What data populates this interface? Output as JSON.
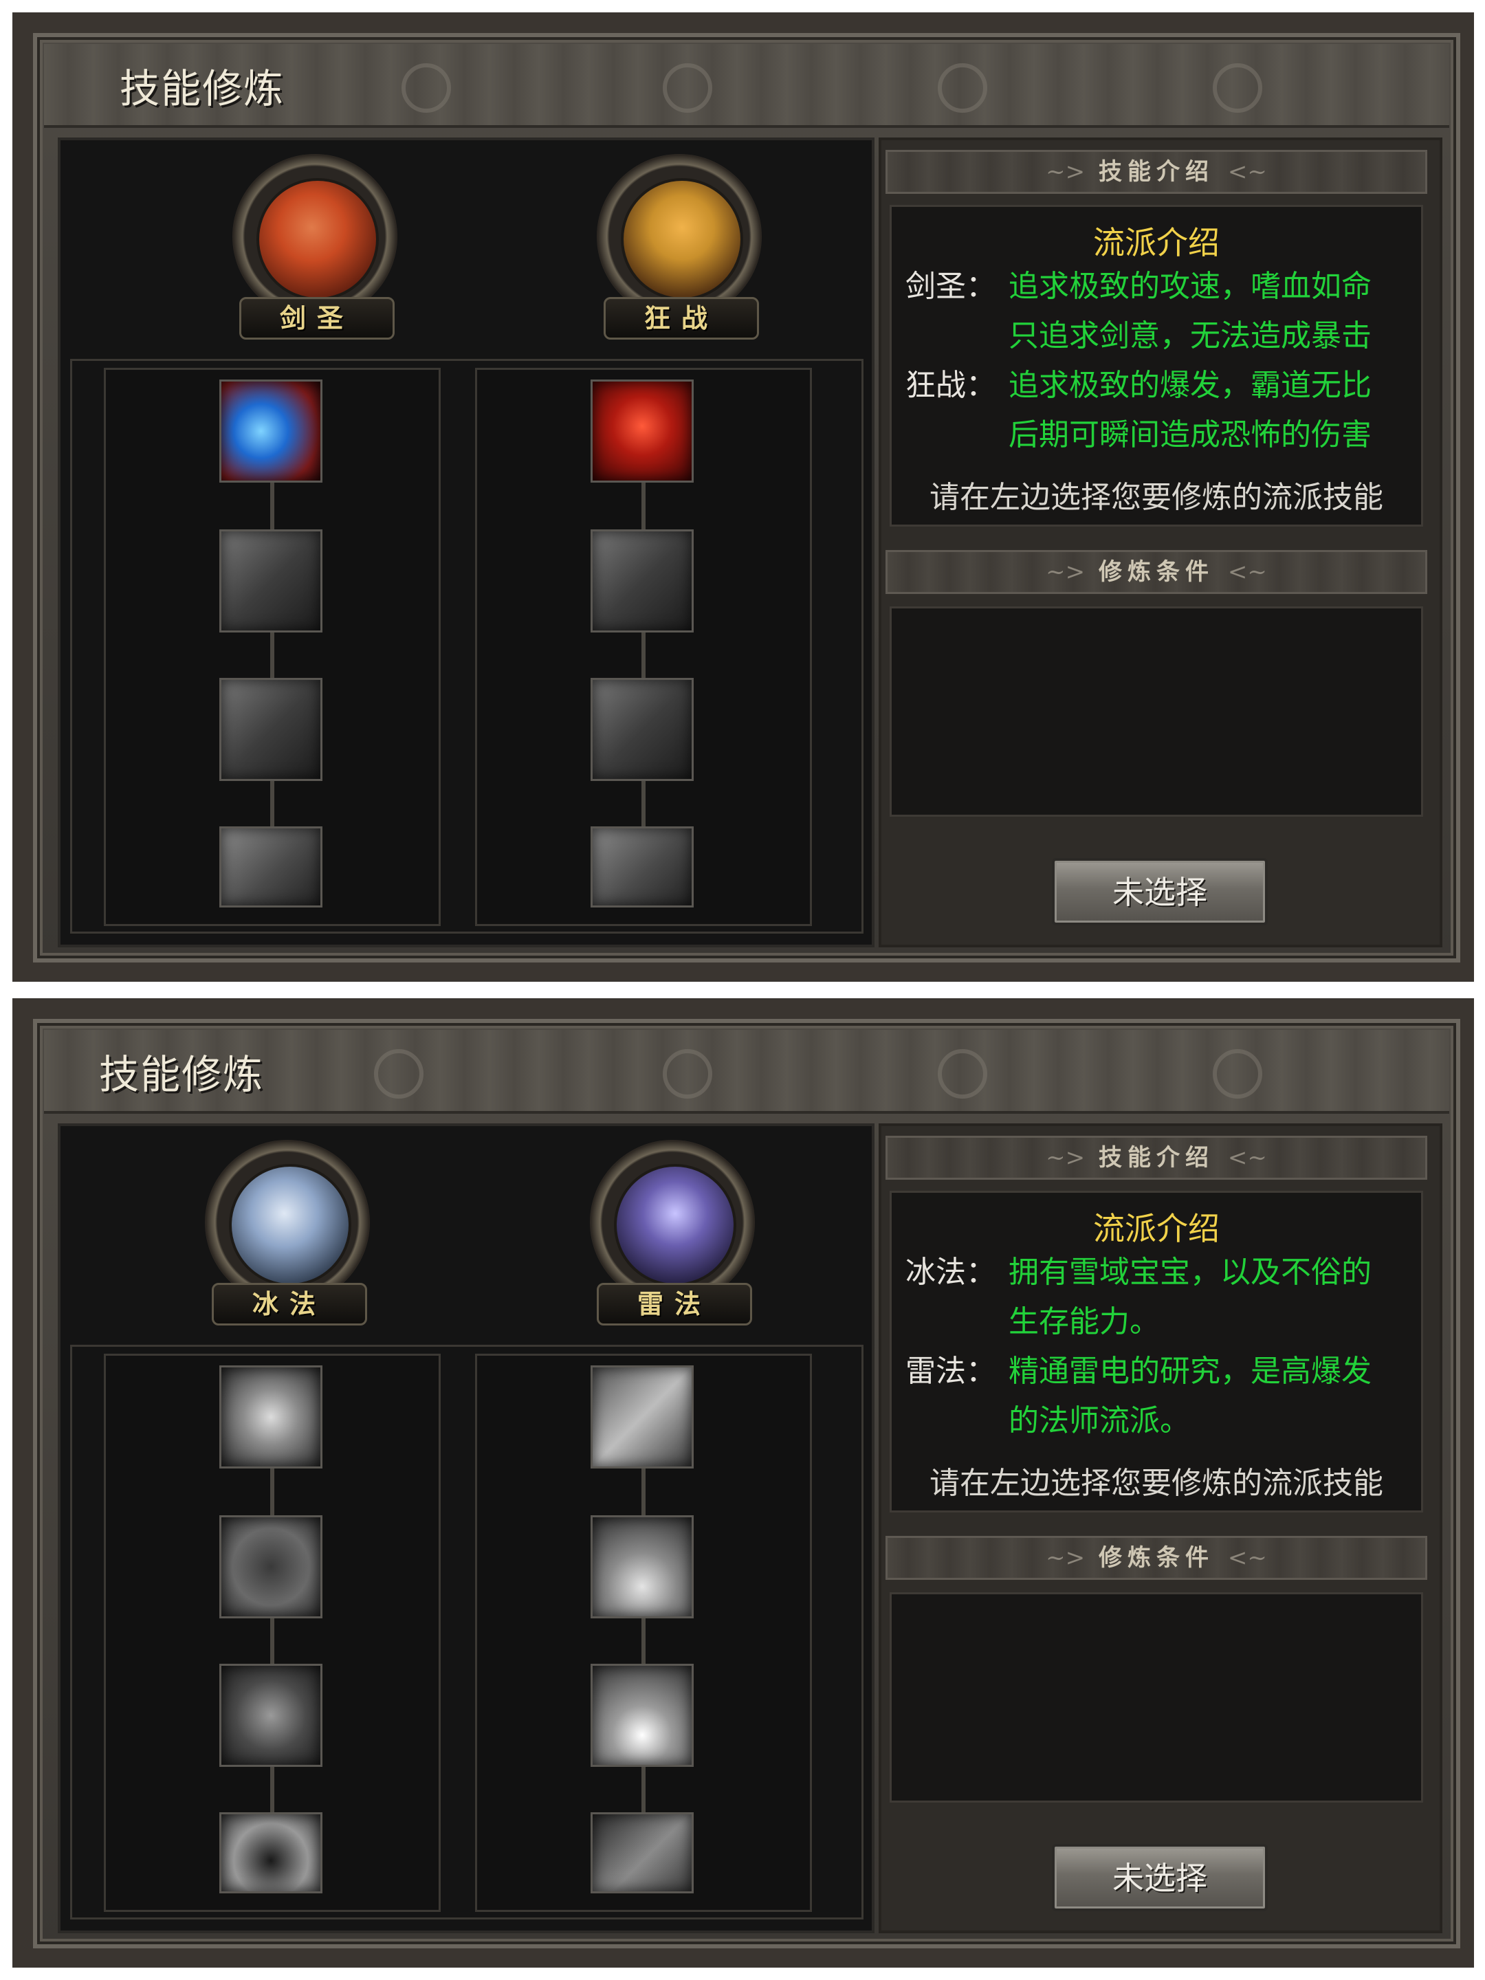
{
  "panels": [
    {
      "title": "技能修炼",
      "classes": [
        {
          "name": "剑圣",
          "face_colors": [
            "#c94a22",
            "#3a1a10"
          ]
        },
        {
          "name": "狂战",
          "face_colors": [
            "#c9902c",
            "#3a2510"
          ]
        }
      ],
      "skill_intro_header": "技能介绍",
      "intro_title": "流派介绍",
      "descriptions": [
        {
          "label": "剑圣：",
          "line1": "追求极致的攻速，嗜血如命",
          "line2": "只追求剑意，无法造成暴击"
        },
        {
          "label": "狂战：",
          "line1": "追求极致的爆发，霸道无比",
          "line2": "后期可瞬间造成恐怖的伤害"
        }
      ],
      "prompt": "请在左边选择您要修炼的流派技能",
      "conditions_header": "修炼条件",
      "button_label": "未选择",
      "left_skills": [
        "blade-wave-icon",
        "sword-icon",
        "sword-icon",
        "slash-icon"
      ],
      "right_skills": [
        "rage-face-icon",
        "sword-icon",
        "sword-icon",
        "warrior-silhouette-icon"
      ]
    },
    {
      "title": "技能修炼",
      "classes": [
        {
          "name": "冰法",
          "face_colors": [
            "#8fa6c8",
            "#1f2a3a"
          ]
        },
        {
          "name": "雷法",
          "face_colors": [
            "#6a5fb0",
            "#1a1630"
          ]
        }
      ],
      "skill_intro_header": "技能介绍",
      "intro_title": "流派介绍",
      "descriptions": [
        {
          "label": "冰法：",
          "line1": "拥有雪域宝宝，以及不俗的",
          "line2": "生存能力。"
        },
        {
          "label": "雷法：",
          "line1": "精通雷电的研究，是高爆发",
          "line2": "的法师流派。"
        }
      ],
      "prompt": "请在左边选择您要修炼的流派技能",
      "conditions_header": "修炼条件",
      "button_label": "未选择",
      "left_skills": [
        "shield-icon",
        "horned-helmet-icon",
        "demon-mask-icon",
        "palm-icon"
      ],
      "right_skills": [
        "crossed-blades-icon",
        "ice-spikes-icon",
        "lightning-storm-icon",
        "lightning-bolt-icon"
      ]
    }
  ],
  "colors": {
    "green_text": "#22d23a",
    "gold_title": "#f2d24a"
  }
}
